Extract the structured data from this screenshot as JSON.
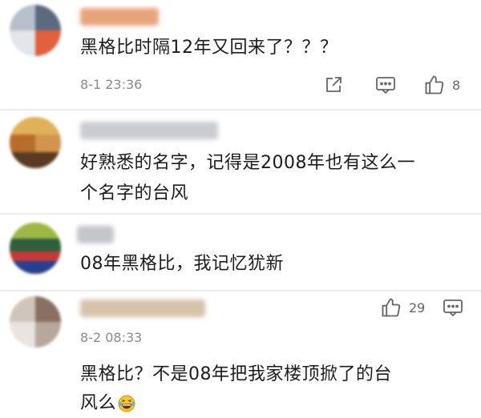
{
  "comments": [
    {
      "text": "黑格比时隔12年又回来了？？？",
      "time": "8-1 23:36",
      "likes": "8"
    },
    {
      "text_line1": "好熟悉的名字，记得是2008年也有这么一",
      "text_line2": "个名字的台风"
    },
    {
      "text": "08年黑格比，我记忆犹新"
    },
    {
      "time": "8-2 08:33",
      "likes": "29",
      "text_line1": "黑格比？不是08年把我家楼顶掀了的台",
      "text_line2": "风么"
    }
  ],
  "icons": {
    "share": "share-icon",
    "comment": "comment-icon",
    "like": "thumbs-up-icon",
    "emoji": "laughing-tears-emoji-icon"
  },
  "colors": {
    "divider": "#ececec",
    "meta": "#8a8a8a"
  }
}
